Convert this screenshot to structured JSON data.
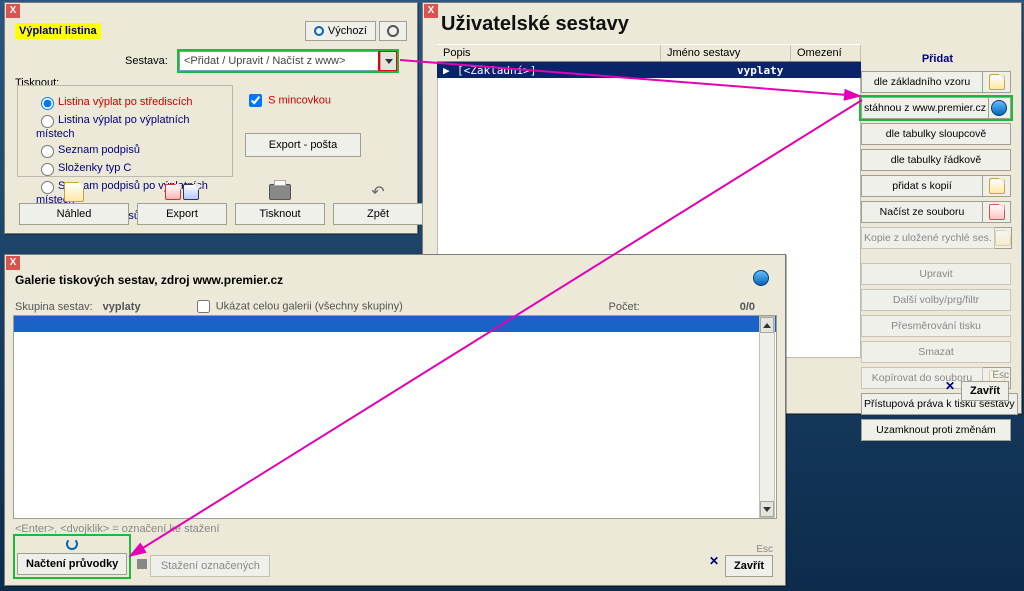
{
  "left": {
    "title": "Výplatní listina",
    "vychozi": "Výchozí",
    "sestava_label": "Sestava:",
    "sestava_value": "<Přidat / Upravit / Načíst z www>",
    "tisknout_label": "Tisknout:",
    "radios": [
      "Listina výplat po střediscích",
      "Listina výplat po výplatních místech",
      "Seznam podpisů",
      "Složenky typ C",
      "Seznam podpisů po výplatních místech",
      "Seznam podpisů po střediscích"
    ],
    "mincovka": "S mincovkou",
    "export_posta": "Export - pošta",
    "btn_nahled": "Náhled",
    "btn_export": "Export",
    "btn_tisknout": "Tisknout",
    "btn_zpet": "Zpět"
  },
  "right": {
    "title": "Uživatelské sestavy",
    "col_popis": "Popis",
    "col_jmeno": "Jméno sestavy",
    "col_omezeni": "Omezení",
    "col_pridat": "Přidat",
    "row_arrow": "▶",
    "row_popis": "[<Základní>]",
    "row_jmeno": "vyplaty",
    "side": [
      "dle základního vzoru",
      "stáhnou z www.premier.cz",
      "dle tabulky sloupcově",
      "dle tabulky řádkově",
      "přidat s kopií",
      "Načíst ze souboru",
      "Kopie z uložené rychlé ses.",
      "Upravit",
      "Další volby/prg/filtr",
      "Přesměrování tisku",
      "Smazat",
      "Kopírovat do souboru",
      "Přístupová práva k tisku sestavy",
      "Uzamknout proti změnám"
    ],
    "esc": "Esc",
    "zavrit": "Zavřít"
  },
  "gal": {
    "title": "Galerie tiskových sestav, zdroj www.premier.cz",
    "skupina_label": "Skupina sestav:",
    "skupina_value": "vyplaty",
    "ukazat": "Ukázat celou galerii (všechny skupiny)",
    "pocet_label": "Počet:",
    "pocet_value": "0/0",
    "hint": "<Enter>, <dvojklik> = označení ke stažení",
    "btn_pruvodky": "Načtení průvodky",
    "btn_stazeni": "Stažení označených",
    "esc": "Esc",
    "zavrit": "Zavřít"
  }
}
